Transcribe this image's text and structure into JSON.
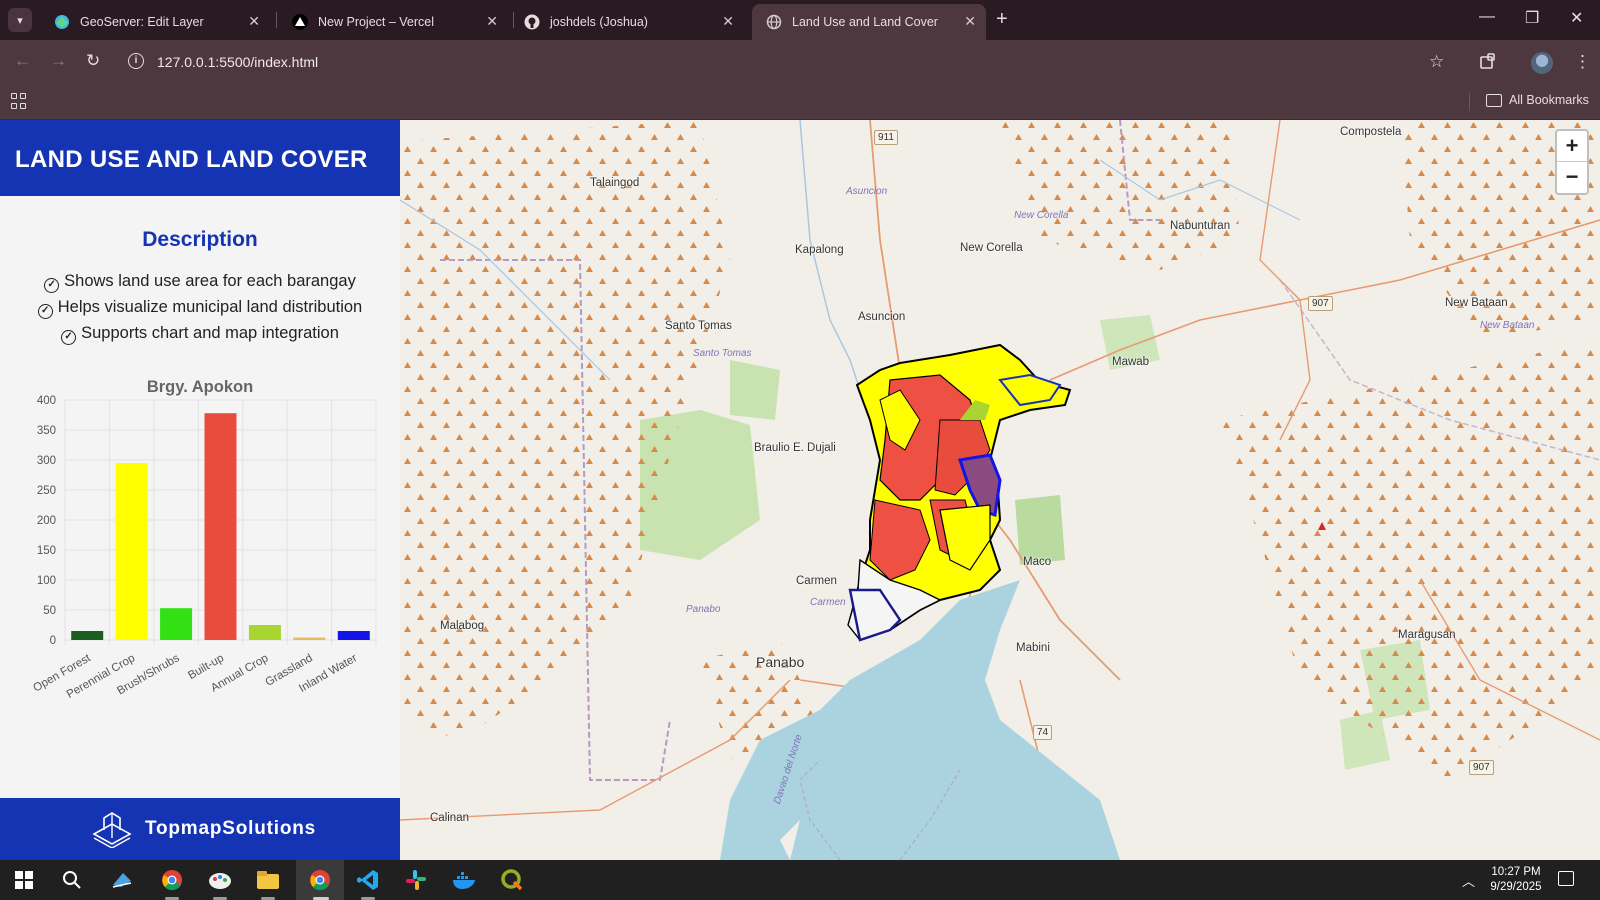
{
  "browser": {
    "tabs": [
      {
        "title": "GeoServer: Edit Layer"
      },
      {
        "title": "New Project – Vercel"
      },
      {
        "title": "joshdels (Joshua)"
      },
      {
        "title": "Land Use and Land Cover"
      }
    ],
    "url": "127.0.0.1:5500/index.html",
    "bookmarks_label": "All Bookmarks"
  },
  "sidebar": {
    "title": "LAND USE AND LAND COVER",
    "description_title": "Description",
    "description_items": [
      "Shows land use area for each barangay",
      "Helps visualize municipal land distribution",
      "Supports chart and map integration"
    ],
    "footer_brand": "TopmapSolutions"
  },
  "chart_data": {
    "type": "bar",
    "title": "Brgy. Apokon",
    "categories": [
      "Open Forest",
      "Perennial Crop",
      "Brush/Shrubs",
      "Built-up",
      "Annual Crop",
      "Grassland",
      "Inland Water"
    ],
    "values": [
      15,
      295,
      53,
      378,
      25,
      4,
      15
    ],
    "colors": [
      "#1b5e20",
      "#ffff00",
      "#33e014",
      "#e74c3c",
      "#a8d531",
      "#e8b960",
      "#1414e8"
    ],
    "ylim": [
      0,
      400
    ],
    "yticks": [
      0,
      50,
      100,
      150,
      200,
      250,
      300,
      350,
      400
    ],
    "grid": true
  },
  "map": {
    "places": [
      {
        "name": "Talaingod"
      },
      {
        "name": "Kapalong"
      },
      {
        "name": "New Corella"
      },
      {
        "name": "Nabunturan"
      },
      {
        "name": "Compostela"
      },
      {
        "name": "Asuncion"
      },
      {
        "name": "Santo Tomas"
      },
      {
        "name": "New Bataan"
      },
      {
        "name": "Mawab"
      },
      {
        "name": "Braulio E. Dujali"
      },
      {
        "name": "Carmen"
      },
      {
        "name": "Maco"
      },
      {
        "name": "Malabog"
      },
      {
        "name": "Panabo"
      },
      {
        "name": "Mabini"
      },
      {
        "name": "Maragusan"
      },
      {
        "name": "Calinan"
      }
    ],
    "water_labels": [
      "Asuncion",
      "New Corella",
      "Santo Tomas",
      "New Bataan",
      "Panabo",
      "Carmen",
      "Davao del Norte"
    ],
    "road_shields": [
      "911",
      "907",
      "74",
      "907"
    ],
    "zoom_in": "+",
    "zoom_out": "−"
  },
  "taskbar": {
    "time": "10:27 PM",
    "date": "9/29/2025"
  }
}
